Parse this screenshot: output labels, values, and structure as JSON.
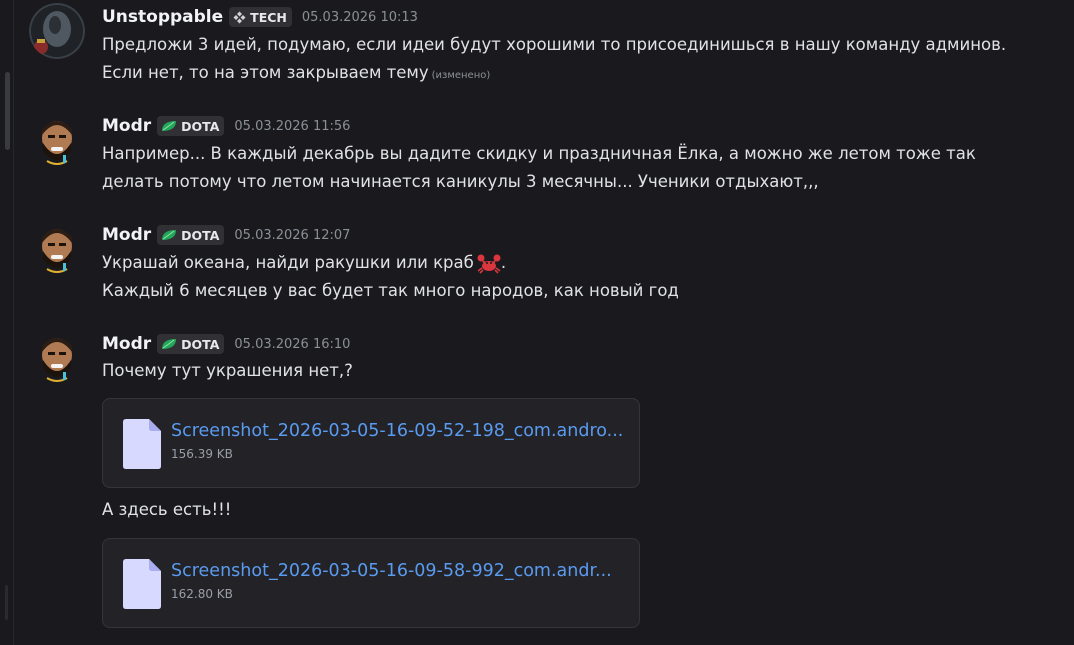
{
  "messages": [
    {
      "author": "Unstoppable",
      "tag": "TECH",
      "timestamp": "05.03.2026 10:13",
      "lines": [
        "Предложи 3 идей, подумаю, если идеи будут хорошими то присоединишься в нашу команду админов.",
        "Если нет, то на этом закрываем тему"
      ],
      "edited_label": "(изменено)"
    },
    {
      "author": "Modr",
      "tag": "DOTA",
      "timestamp": "05.03.2026 11:56",
      "lines": [
        "Например... В каждый декабрь вы дадите скидку и праздничная Ёлка, а можно же летом тоже так",
        "делать потому что летом начинается каникулы 3 месячны... Ученики отдыхают,,,"
      ]
    },
    {
      "author": "Modr",
      "tag": "DOTA",
      "timestamp": "05.03.2026 12:07",
      "lines": [
        "Украшай океана, найди ракушки или краб",
        "Каждый 6 месяцев у вас будет так много народов, как новый год"
      ],
      "line_end": "."
    },
    {
      "author": "Modr",
      "tag": "DOTA",
      "timestamp": "05.03.2026 16:10",
      "lines": [
        "Почему тут украшения нет,?"
      ],
      "attachment": {
        "name": "Screenshot_2026-03-05-16-09-52-198_com.andro...",
        "size": "156.39 KB"
      },
      "followup": "А здесь есть!!!",
      "attachment2": {
        "name": "Screenshot_2026-03-05-16-09-58-992_com.andr...",
        "size": "162.80 KB"
      }
    }
  ],
  "colors": {
    "background": "#1a1a1e",
    "username": "#f2f3f5",
    "link": "#5a9bf0",
    "timestamp": "#8b8f97",
    "dota_leaf": "#23a55a"
  },
  "icons": {
    "tech_tag": "diamond-arrows-icon",
    "dota_tag": "green-leaf-icon",
    "attachment": "file-document-icon",
    "emoji": "crab-emoji"
  }
}
